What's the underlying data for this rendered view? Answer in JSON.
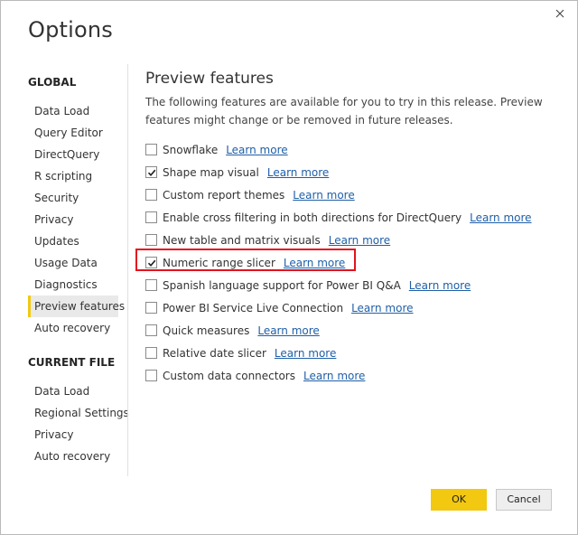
{
  "window": {
    "title": "Options"
  },
  "nav": {
    "global_heading": "GLOBAL",
    "global_items": [
      "Data Load",
      "Query Editor",
      "DirectQuery",
      "R scripting",
      "Security",
      "Privacy",
      "Updates",
      "Usage Data",
      "Diagnostics",
      "Preview features",
      "Auto recovery"
    ],
    "selected": "Preview features",
    "current_file_heading": "CURRENT FILE",
    "current_file_items": [
      "Data Load",
      "Regional Settings",
      "Privacy",
      "Auto recovery"
    ]
  },
  "content": {
    "heading": "Preview features",
    "description": "The following features are available for you to try in this release. Preview features might change or be removed in future releases.",
    "link_label": "Learn more",
    "features": [
      {
        "label": "Snowflake",
        "checked": false
      },
      {
        "label": "Shape map visual",
        "checked": true
      },
      {
        "label": "Custom report themes",
        "checked": false
      },
      {
        "label": "Enable cross filtering in both directions for DirectQuery",
        "checked": false
      },
      {
        "label": "New table and matrix visuals",
        "checked": false
      },
      {
        "label": "Numeric range slicer",
        "checked": true
      },
      {
        "label": "Spanish language support for Power BI Q&A",
        "checked": false
      },
      {
        "label": "Power BI Service Live Connection",
        "checked": false
      },
      {
        "label": "Quick measures",
        "checked": false
      },
      {
        "label": "Relative date slicer",
        "checked": false
      },
      {
        "label": "Custom data connectors",
        "checked": false
      }
    ]
  },
  "buttons": {
    "ok_label": "OK",
    "cancel_label": "Cancel"
  },
  "colors": {
    "accent": "#f2c811",
    "link": "#1f5fa8",
    "highlight": "#e3131c"
  },
  "icons": {
    "close": "close-icon",
    "check": "checkmark-icon"
  }
}
